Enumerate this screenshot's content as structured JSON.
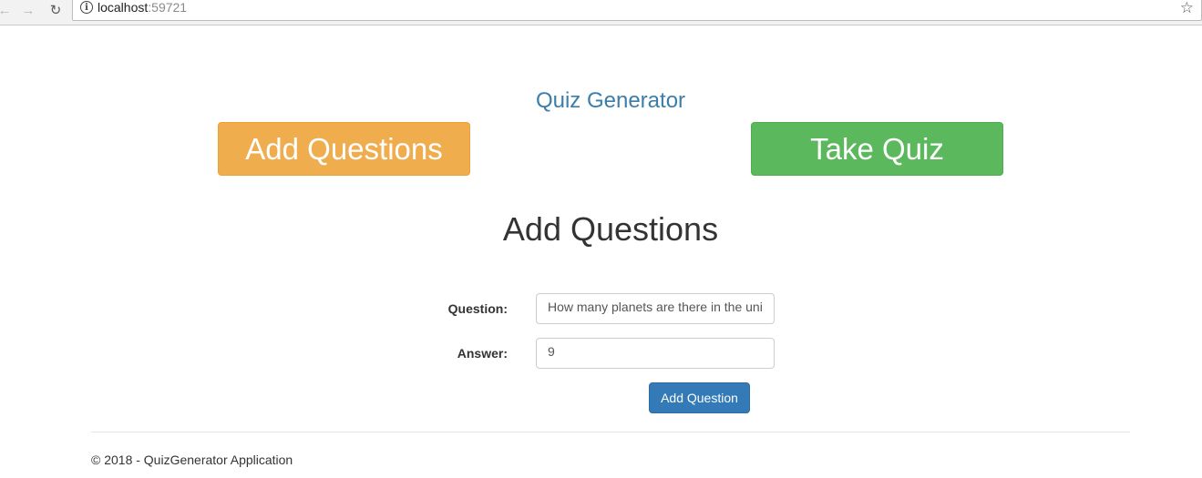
{
  "browser": {
    "url_host": "localhost",
    "url_port": ":59721"
  },
  "site": {
    "title": "Quiz Generator"
  },
  "nav_buttons": {
    "add_questions": "Add Questions",
    "take_quiz": "Take Quiz"
  },
  "main": {
    "heading": "Add Questions",
    "question_label": "Question:",
    "question_value": "How many planets are there in the uni",
    "answer_label": "Answer:",
    "answer_value": "9",
    "submit_label": "Add Question"
  },
  "footer": {
    "text": "© 2018 - QuizGenerator Application"
  },
  "colors": {
    "brand_link": "#3c7ea9",
    "warning": "#f0ad4e",
    "success": "#5cb85c",
    "primary": "#337ab7"
  }
}
